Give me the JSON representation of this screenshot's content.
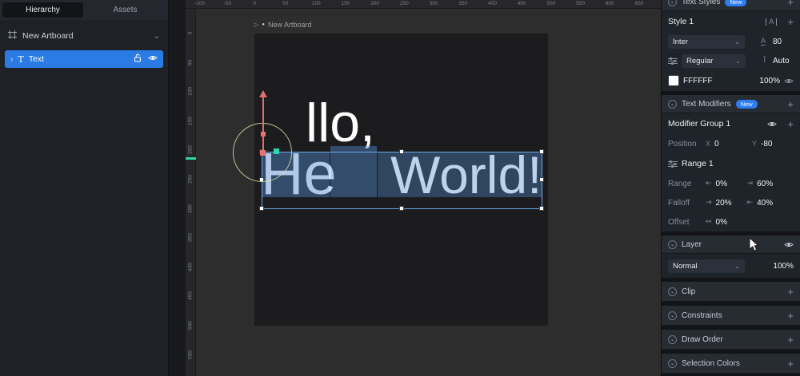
{
  "left_panel": {
    "tabs": {
      "hierarchy": "Hierarchy",
      "assets": "Assets"
    },
    "artboard_row_label": "New Artboard",
    "text_layer_label": "Text"
  },
  "canvas": {
    "artboard_title": "New Artboard",
    "text": {
      "raised": "llo,",
      "left": "He",
      "right": "World!"
    },
    "top_ruler_labels": [
      "-100",
      "-50",
      "0",
      "50",
      "100",
      "150",
      "200",
      "250",
      "300",
      "350",
      "400",
      "450",
      "500",
      "550",
      "600",
      "650"
    ],
    "left_ruler_labels": [
      "0",
      "50",
      "100",
      "150",
      "200",
      "250",
      "300",
      "350",
      "400",
      "450",
      "500",
      "550"
    ]
  },
  "right_panel": {
    "text_styles_title": "Text Styles",
    "text_styles_badge": "New",
    "style_name": "Style 1",
    "font_family": "Inter",
    "font_size": "80",
    "font_weight": "Regular",
    "line_height": "Auto",
    "color_hex": "FFFFFF",
    "color_opacity": "100%",
    "modifiers_title": "Text Modifiers",
    "modifiers_badge": "New",
    "modifier_group_name": "Modifier Group 1",
    "position_label": "Position",
    "position_x_label": "X",
    "position_x": "0",
    "position_y_label": "Y",
    "position_y": "-80",
    "range_group_name": "Range 1",
    "range_label": "Range",
    "range_start": "0%",
    "range_end": "60%",
    "falloff_label": "Falloff",
    "falloff_in": "20%",
    "falloff_out": "40%",
    "offset_label": "Offset",
    "offset_value": "0%",
    "layer_title": "Layer",
    "blend_mode": "Normal",
    "layer_opacity": "100%",
    "clip_title": "Clip",
    "constraints_title": "Constraints",
    "draw_order_title": "Draw Order",
    "selection_colors_title": "Selection Colors"
  },
  "icons": {
    "chevron_down": "⌄",
    "chevron_right": "›",
    "plus": "+",
    "play": "▷",
    "dot": "●",
    "size": "A",
    "auto_height": "Ī",
    "range_start": "⇤",
    "range_end": "⇥",
    "falloff_in": "⇥",
    "falloff_out": "⇤",
    "offset": "↔",
    "align": "A"
  }
}
